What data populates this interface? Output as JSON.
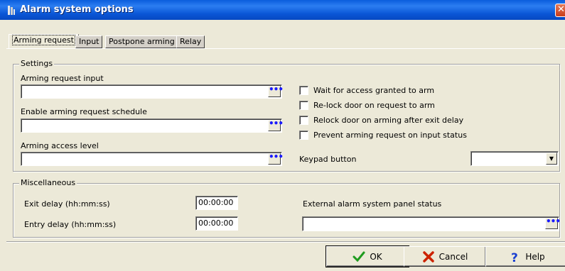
{
  "window": {
    "title": "Alarm system options",
    "close_glyph": "✕"
  },
  "tabs": [
    {
      "label": "Arming request",
      "active": true
    },
    {
      "label": "Input",
      "active": false
    },
    {
      "label": "Postpone arming",
      "active": false
    },
    {
      "label": "Relay",
      "active": false
    }
  ],
  "settings": {
    "group_label": "Settings",
    "arming_request_input": {
      "label": "Arming request input",
      "value": ""
    },
    "enable_arming_schedule": {
      "label": "Enable arming request schedule",
      "value": ""
    },
    "arming_access_level": {
      "label": "Arming access level",
      "value": ""
    },
    "browse_glyph": "•••",
    "checkboxes": [
      {
        "label": "Wait for access granted to arm",
        "checked": false
      },
      {
        "label": "Re-lock door on request to arm",
        "checked": false
      },
      {
        "label": "Relock door on arming after exit delay",
        "checked": false
      },
      {
        "label": "Prevent arming request on input status",
        "checked": false
      }
    ],
    "keypad_button": {
      "label": "Keypad button",
      "value": ""
    }
  },
  "misc": {
    "group_label": "Miscellaneous",
    "exit_delay": {
      "label": "Exit delay (hh:mm:ss)",
      "value": "00:00:00"
    },
    "entry_delay": {
      "label": "Entry delay (hh:mm:ss)",
      "value": "00:00:00"
    },
    "external_status": {
      "label": "External alarm system panel status",
      "value": ""
    }
  },
  "buttons": {
    "ok": "OK",
    "cancel": "Cancel",
    "help": "Help"
  },
  "colors": {
    "titlebar": "#0a56d6",
    "browse_dots": "#1a1aff",
    "ok_check": "#1e9b1e",
    "cancel_x": "#cc2200",
    "help_q": "#1a3fd1"
  },
  "icons": {
    "app": "app-icon",
    "ok": "check-icon",
    "cancel": "x-icon",
    "help": "question-icon",
    "browse": "ellipsis-icon",
    "dropdown": "chevron-down-icon"
  }
}
